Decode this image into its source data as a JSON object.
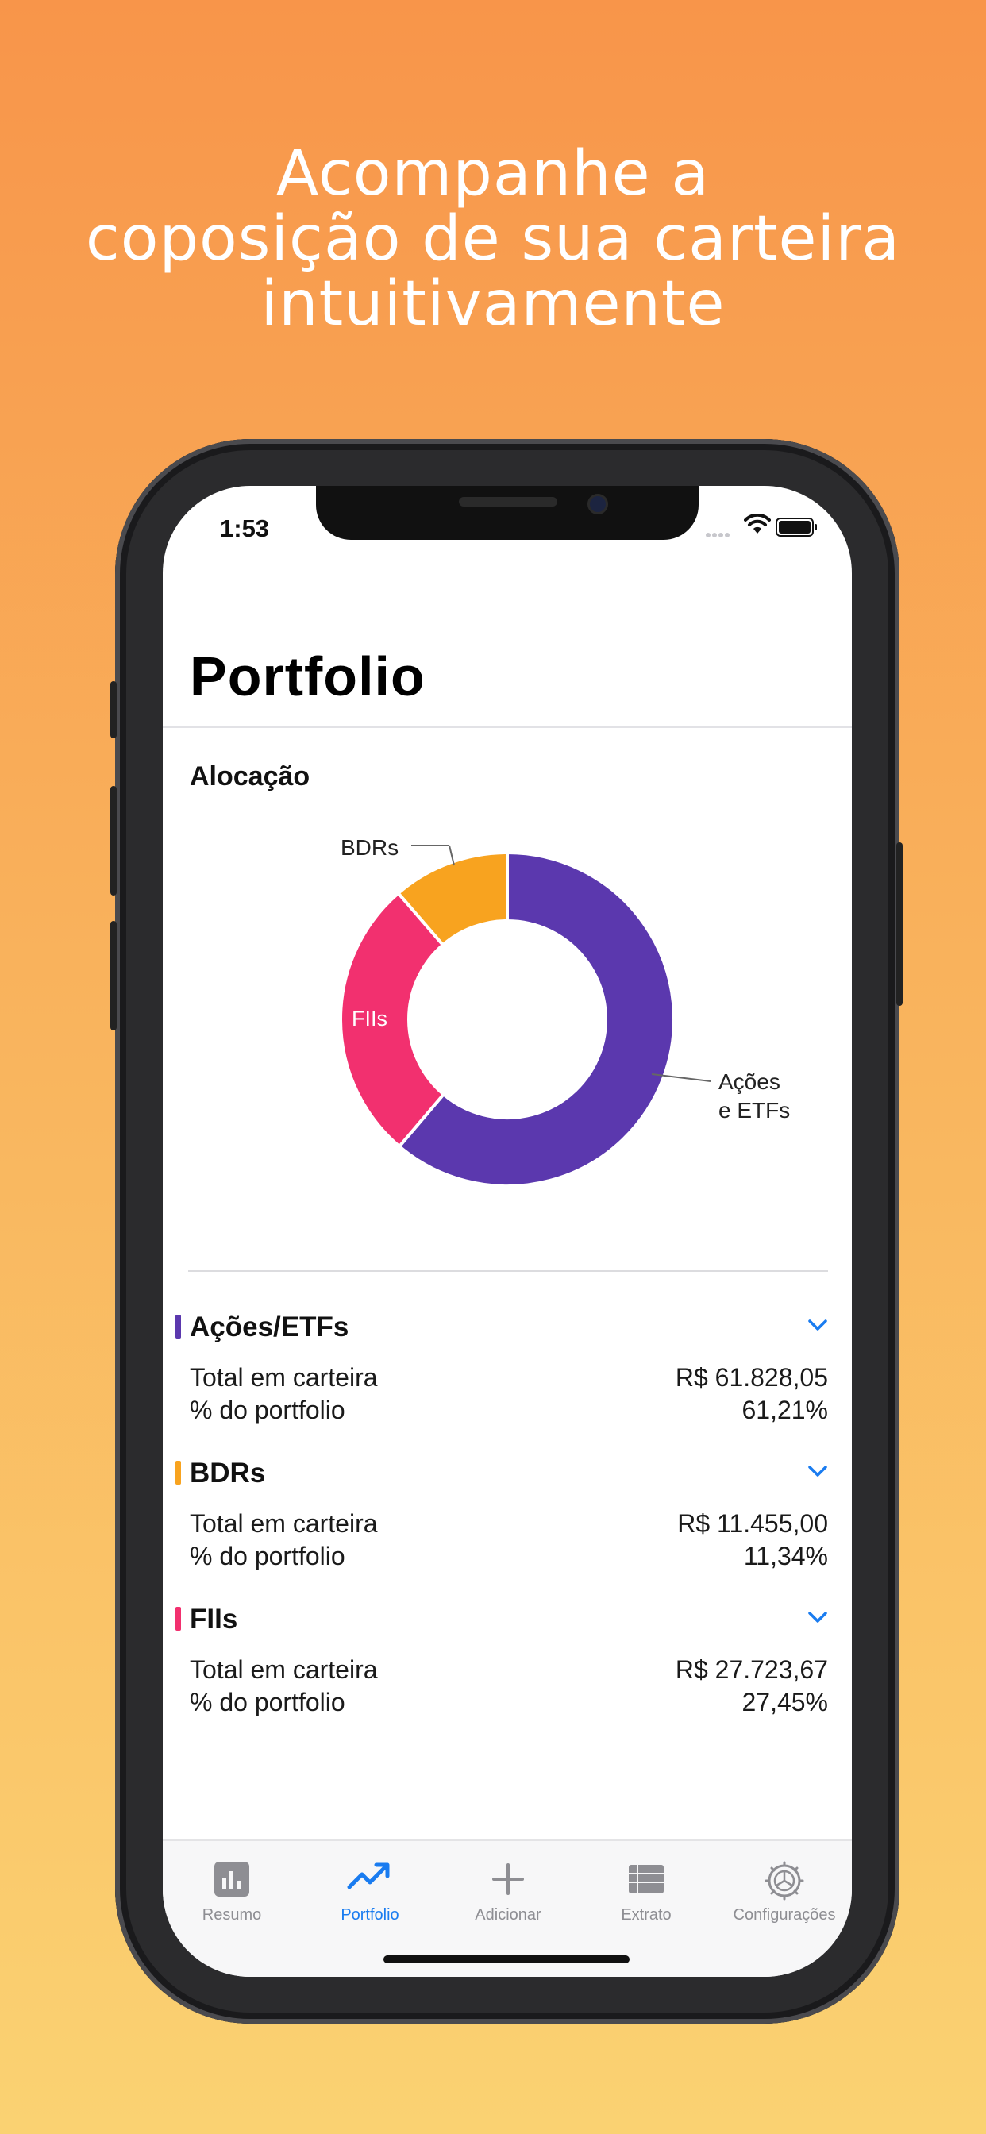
{
  "headline": [
    "Acompanhe a",
    "coposição de sua carteira",
    "intuitivamente"
  ],
  "status": {
    "time": "1:53"
  },
  "page": {
    "title": "Portfolio",
    "section": "Alocação"
  },
  "chart_data": {
    "type": "pie",
    "style": "donut",
    "title": "Alocação",
    "slices": [
      {
        "label": "Ações e ETFs",
        "value": 61.21,
        "color": "#5B38AE"
      },
      {
        "label": "FIIs",
        "value": 27.45,
        "color": "#F2306F"
      },
      {
        "label": "BDRs",
        "value": 11.34,
        "color": "#F8A31F"
      }
    ],
    "annotations": {
      "acoes_line1": "Ações",
      "acoes_line2": "e ETFs",
      "fiis": "FIIs",
      "bdrs": "BDRs"
    }
  },
  "groups": [
    {
      "name": "Ações/ETFs",
      "color": "#5B38AE",
      "total_label": "Total em carteira",
      "total": "R$ 61.828,05",
      "pct_label": "% do portfolio",
      "pct": "61,21%"
    },
    {
      "name": "BDRs",
      "color": "#F8A31F",
      "total_label": "Total em carteira",
      "total": "R$ 11.455,00",
      "pct_label": "% do portfolio",
      "pct": "11,34%"
    },
    {
      "name": "FIIs",
      "color": "#F2306F",
      "total_label": "Total em carteira",
      "total": "R$ 27.723,67",
      "pct_label": "% do portfolio",
      "pct": "27,45%"
    }
  ],
  "tabs": [
    {
      "label": "Resumo",
      "icon": "chart-bar-icon"
    },
    {
      "label": "Portfolio",
      "icon": "trending-up-icon",
      "active": true
    },
    {
      "label": "Adicionar",
      "icon": "plus-icon"
    },
    {
      "label": "Extrato",
      "icon": "list-icon"
    },
    {
      "label": "Configurações",
      "icon": "gear-icon"
    }
  ],
  "accent_color": "#1A7CF0"
}
